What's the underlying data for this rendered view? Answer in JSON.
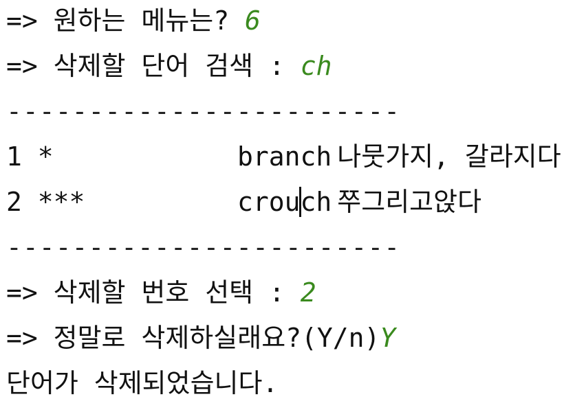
{
  "console": {
    "menu_prompt": "=> 원하는 메뉴는? ",
    "menu_choice": "6",
    "search_prompt": "=> 삭제할 단어 검색 : ",
    "search_term": "ch",
    "separator": "------------------------",
    "results": [
      {
        "index": "1",
        "stars": "*",
        "word": "branch",
        "meaning": "나뭇가지, 갈라지다"
      },
      {
        "index": "2",
        "stars": "***",
        "word_before_cursor": "crou",
        "word_after_cursor": "ch",
        "meaning": "쭈그리고앉다"
      }
    ],
    "select_prompt": "=> 삭제할 번호 선택 : ",
    "select_choice": "2",
    "confirm_prompt": "=> 정말로 삭제하실래요?(Y/n)",
    "confirm_choice": "Y",
    "result_message": "단어가 삭제되었습니다."
  }
}
